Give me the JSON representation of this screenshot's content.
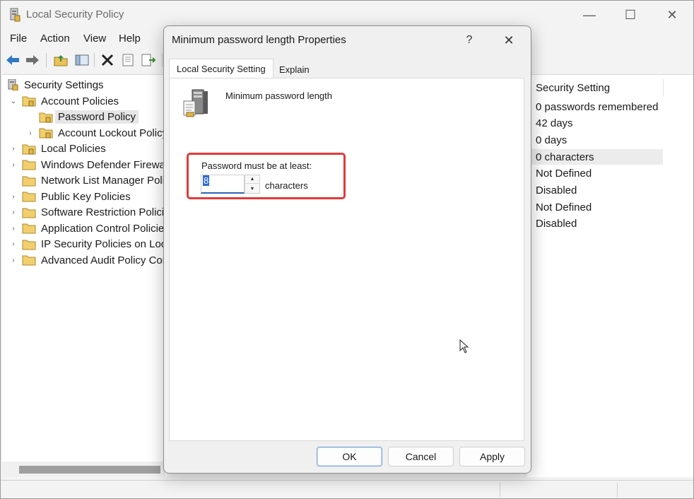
{
  "window": {
    "title": "Local Security Policy",
    "controls": {
      "minimize": "—",
      "maximize": "☐",
      "close": "✕"
    }
  },
  "menu": [
    "File",
    "Action",
    "View",
    "Help"
  ],
  "tree": {
    "root": "Security Settings",
    "items": [
      {
        "label": "Account Policies",
        "level": 1,
        "expander": "⌄"
      },
      {
        "label": "Password Policy",
        "level": 2,
        "expander": "",
        "selected": true
      },
      {
        "label": "Account Lockout Policy",
        "level": 2,
        "expander": "›"
      },
      {
        "label": "Local Policies",
        "level": 1,
        "expander": "›"
      },
      {
        "label": "Windows Defender Firewall",
        "level": 1,
        "expander": "›"
      },
      {
        "label": "Network List Manager Polic",
        "level": 1,
        "expander": ""
      },
      {
        "label": "Public Key Policies",
        "level": 1,
        "expander": "›"
      },
      {
        "label": "Software Restriction Policie",
        "level": 1,
        "expander": "›"
      },
      {
        "label": "Application Control Policies",
        "level": 1,
        "expander": "›"
      },
      {
        "label": "IP Security Policies on Local",
        "level": 1,
        "expander": "›"
      },
      {
        "label": "Advanced Audit Policy Con",
        "level": 1,
        "expander": "›"
      }
    ]
  },
  "settings_column": {
    "header": "Security Setting",
    "values": [
      "0 passwords remembered",
      "42 days",
      "0 days",
      "0 characters",
      "Not Defined",
      "Disabled",
      "Not Defined",
      "Disabled"
    ],
    "highlighted_index": 3
  },
  "dialog": {
    "title": "Minimum password length Properties",
    "help": "?",
    "close": "✕",
    "tabs": [
      "Local Security Setting",
      "Explain"
    ],
    "policy_name": "Minimum password length",
    "field_label": "Password must be at least:",
    "field_value": "8",
    "unit": "characters",
    "spin_up": "▲",
    "spin_down": "▼",
    "buttons": {
      "ok": "OK",
      "cancel": "Cancel",
      "apply": "Apply"
    }
  },
  "colors": {
    "highlight_border": "#e03a3a",
    "selection": "#2f6bd1"
  }
}
